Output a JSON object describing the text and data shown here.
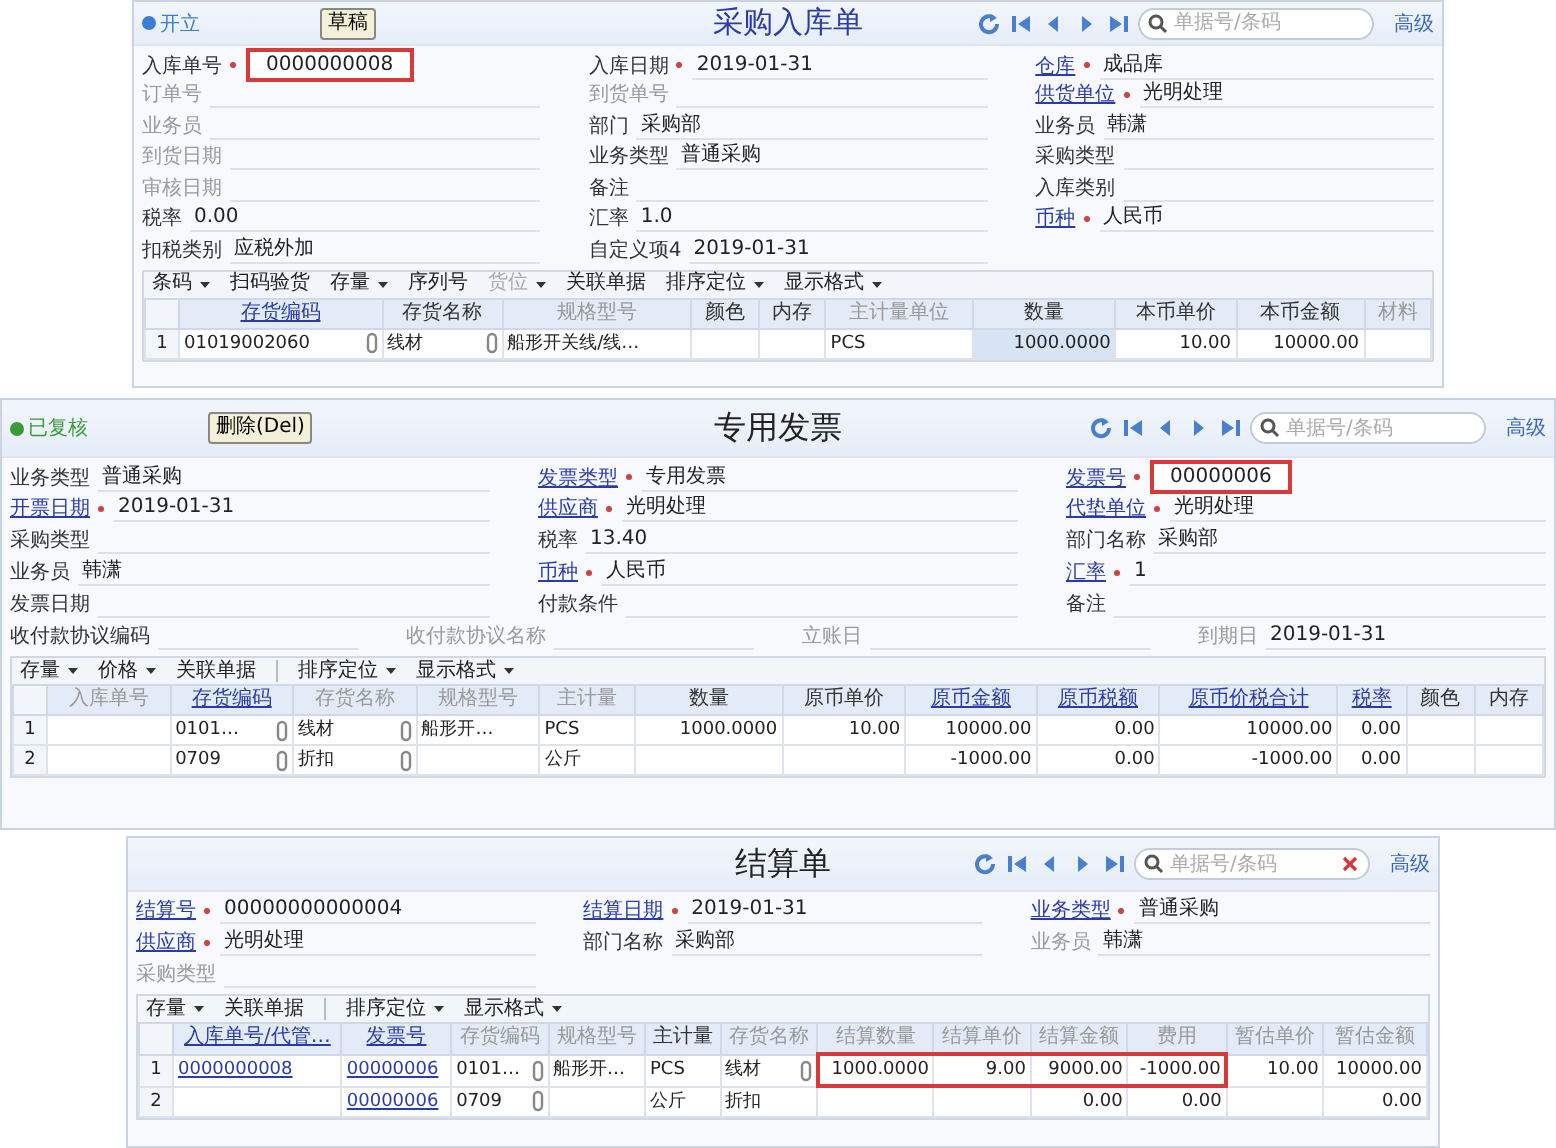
{
  "panels": [
    {
      "status": {
        "text": "开立",
        "color": "#3b7fd4"
      },
      "button": "草稿",
      "title": "采购入库单",
      "search": {
        "placeholder": "单据号/条码",
        "clearable": false
      },
      "advanced": "高级",
      "fields": [
        [
          {
            "label": "入库单号",
            "kind": "plain",
            "required": true,
            "value": "0000000008",
            "boxed": true
          },
          {
            "label": "入库日期",
            "kind": "plain",
            "required": true,
            "value": "2019-01-31"
          },
          {
            "label": "仓库",
            "kind": "link",
            "required": true,
            "value": "成品库"
          }
        ],
        [
          {
            "label": "订单号",
            "kind": "dim"
          },
          {
            "label": "到货单号",
            "kind": "dim"
          },
          {
            "label": "供货单位",
            "kind": "link",
            "required": true,
            "value": "光明处理"
          }
        ],
        [
          {
            "label": "业务员",
            "kind": "dim"
          },
          {
            "label": "部门",
            "kind": "plain",
            "value": "采购部"
          },
          {
            "label": "业务员",
            "kind": "plain",
            "value": "韩潇"
          }
        ],
        [
          {
            "label": "到货日期",
            "kind": "dim"
          },
          {
            "label": "业务类型",
            "kind": "plain",
            "value": "普通采购"
          },
          {
            "label": "采购类型",
            "kind": "plain"
          }
        ],
        [
          {
            "label": "审核日期",
            "kind": "dim"
          },
          {
            "label": "备注",
            "kind": "plain"
          },
          {
            "label": "入库类别",
            "kind": "plain"
          }
        ],
        [
          {
            "label": "税率",
            "kind": "plain",
            "value": "0.00"
          },
          {
            "label": "汇率",
            "kind": "plain",
            "value": "1.0"
          },
          {
            "label": "币种",
            "kind": "link",
            "required": true,
            "value": "人民币"
          }
        ],
        [
          {
            "label": "扣税类别",
            "kind": "plain",
            "value": "应税外加"
          },
          {
            "label": "自定义项4",
            "kind": "plain",
            "value": "2019-01-31"
          }
        ]
      ],
      "table": {
        "toolbar": [
          {
            "label": "条码",
            "dropdown": true
          },
          {
            "label": "扫码验货"
          },
          {
            "label": "存量",
            "dropdown": true
          },
          {
            "label": "序列号"
          },
          {
            "label": "货位",
            "dropdown": true,
            "disabled": true
          },
          {
            "label": "关联单据"
          },
          {
            "label": "排序定位",
            "dropdown": true
          },
          {
            "label": "显示格式",
            "dropdown": true
          }
        ],
        "columns": [
          {
            "label": "存货编码",
            "kind": "link"
          },
          {
            "label": "存货名称",
            "kind": "plain"
          },
          {
            "label": "规格型号",
            "kind": "dim"
          },
          {
            "label": "颜色",
            "kind": "plain"
          },
          {
            "label": "内存",
            "kind": "plain"
          },
          {
            "label": "主计量单位",
            "kind": "dim"
          },
          {
            "label": "数量",
            "kind": "plain"
          },
          {
            "label": "本币单价",
            "kind": "plain"
          },
          {
            "label": "本币金额",
            "kind": "plain"
          },
          {
            "label": "材料",
            "kind": "dim"
          }
        ],
        "rows": [
          {
            "number": "1",
            "cells": [
              {
                "text": "01019002060",
                "ref": true
              },
              {
                "text": "线材",
                "ref": true
              },
              {
                "text": "船形开关线/线…"
              },
              {},
              {},
              {
                "text": "PCS"
              },
              {
                "text": "1000.0000",
                "num": true,
                "selected": true
              },
              {
                "text": "10.00",
                "num": true
              },
              {
                "text": "10000.00",
                "num": true
              },
              {}
            ]
          }
        ]
      }
    },
    {
      "status": {
        "text": "已复核",
        "color": "#3a9a3a"
      },
      "button": "删除(Del)",
      "title": "专用发票",
      "search": {
        "placeholder": "单据号/条码",
        "clearable": false
      },
      "advanced": "高级",
      "fields": [
        [
          {
            "label": "业务类型",
            "kind": "plain",
            "value": "普通采购"
          },
          {
            "label": "发票类型",
            "kind": "link",
            "required": true,
            "value": "专用发票"
          },
          {
            "label": "发票号",
            "kind": "link",
            "required": true,
            "value": "00000006",
            "boxed": true
          }
        ],
        [
          {
            "label": "开票日期",
            "kind": "link",
            "required": true,
            "value": "2019-01-31"
          },
          {
            "label": "供应商",
            "kind": "link",
            "required": true,
            "value": "光明处理"
          },
          {
            "label": "代垫单位",
            "kind": "link",
            "required": true,
            "value": "光明处理"
          }
        ],
        [
          {
            "label": "采购类型",
            "kind": "plain"
          },
          {
            "label": "税率",
            "kind": "plain",
            "value": "13.40"
          },
          {
            "label": "部门名称",
            "kind": "plain",
            "value": "采购部"
          }
        ],
        [
          {
            "label": "业务员",
            "kind": "plain",
            "value": "韩潇"
          },
          {
            "label": "币种",
            "kind": "link",
            "required": true,
            "value": "人民币"
          },
          {
            "label": "汇率",
            "kind": "link",
            "required": true,
            "value": "1"
          }
        ],
        [
          {
            "label": "发票日期",
            "kind": "plain"
          },
          {
            "label": "付款条件",
            "kind": "plain"
          },
          {
            "label": "备注",
            "kind": "plain"
          }
        ],
        [
          {
            "label": "收付款协议编码",
            "kind": "plain"
          },
          {
            "label": "收付款协议名称",
            "kind": "dim"
          },
          {
            "label": "立账日",
            "kind": "dim"
          },
          {
            "label": "到期日",
            "kind": "dim",
            "value": "2019-01-31"
          }
        ]
      ],
      "table": {
        "toolbar": [
          {
            "label": "存量",
            "dropdown": true
          },
          {
            "label": "价格",
            "dropdown": true
          },
          {
            "label": "关联单据"
          },
          {
            "label": "排序定位",
            "dropdown": true,
            "separator_before": true
          },
          {
            "label": "显示格式",
            "dropdown": true
          }
        ],
        "columns": [
          {
            "label": "入库单号",
            "kind": "dim"
          },
          {
            "label": "存货编码",
            "kind": "link"
          },
          {
            "label": "存货名称",
            "kind": "dim"
          },
          {
            "label": "规格型号",
            "kind": "dim"
          },
          {
            "label": "主计量",
            "kind": "dim"
          },
          {
            "label": "数量",
            "kind": "plain"
          },
          {
            "label": "原币单价",
            "kind": "plain"
          },
          {
            "label": "原币金额",
            "kind": "link"
          },
          {
            "label": "原币税额",
            "kind": "link"
          },
          {
            "label": "原币价税合计",
            "kind": "link"
          },
          {
            "label": "税率",
            "kind": "link"
          },
          {
            "label": "颜色",
            "kind": "plain"
          },
          {
            "label": "内存",
            "kind": "plain"
          }
        ],
        "rows": [
          {
            "number": "1",
            "cells": [
              {},
              {
                "text": "0101…",
                "ref": true
              },
              {
                "text": "线材",
                "ref": true
              },
              {
                "text": "船形开…"
              },
              {
                "text": "PCS"
              },
              {
                "text": "1000.0000",
                "num": true
              },
              {
                "text": "10.00",
                "num": true
              },
              {
                "text": "10000.00",
                "num": true
              },
              {
                "text": "0.00",
                "num": true
              },
              {
                "text": "10000.00",
                "num": true
              },
              {
                "text": "0.00",
                "num": true
              },
              {},
              {}
            ]
          },
          {
            "number": "2",
            "cells": [
              {},
              {
                "text": "0709",
                "ref": true
              },
              {
                "text": "折扣",
                "ref": true
              },
              {},
              {
                "text": "公斤"
              },
              {},
              {},
              {
                "text": "-1000.00",
                "num": true
              },
              {
                "text": "0.00",
                "num": true
              },
              {
                "text": "-1000.00",
                "num": true
              },
              {
                "text": "0.00",
                "num": true
              },
              {},
              {}
            ]
          }
        ]
      }
    },
    {
      "title": "结算单",
      "search": {
        "placeholder": "单据号/条码",
        "clearable": true
      },
      "advanced": "高级",
      "fields": [
        [
          {
            "label": "结算号",
            "kind": "link",
            "required": true,
            "value": "00000000000004"
          },
          {
            "label": "结算日期",
            "kind": "link",
            "required": true,
            "value": "2019-01-31"
          },
          {
            "label": "业务类型",
            "kind": "link",
            "required": true,
            "value": "普通采购"
          }
        ],
        [
          {
            "label": "供应商",
            "kind": "link",
            "required": true,
            "value": "光明处理"
          },
          {
            "label": "部门名称",
            "kind": "plain",
            "value": "采购部"
          },
          {
            "label": "业务员",
            "kind": "dim",
            "value": "韩潇"
          }
        ],
        [
          {
            "label": "采购类型",
            "kind": "dim"
          }
        ]
      ],
      "table": {
        "toolbar": [
          {
            "label": "存量",
            "dropdown": true
          },
          {
            "label": "关联单据"
          },
          {
            "label": "排序定位",
            "dropdown": true,
            "separator_before": true
          },
          {
            "label": "显示格式",
            "dropdown": true
          }
        ],
        "columns": [
          {
            "label": "入库单号/代管…",
            "kind": "link"
          },
          {
            "label": "发票号",
            "kind": "link"
          },
          {
            "label": "存货编码",
            "kind": "dim"
          },
          {
            "label": "规格型号",
            "kind": "dim"
          },
          {
            "label": "主计量",
            "kind": "plain"
          },
          {
            "label": "存货名称",
            "kind": "dim"
          },
          {
            "label": "结算数量",
            "kind": "dim"
          },
          {
            "label": "结算单价",
            "kind": "dim"
          },
          {
            "label": "结算金额",
            "kind": "dim"
          },
          {
            "label": "费用",
            "kind": "dim"
          },
          {
            "label": "暂估单价",
            "kind": "dim"
          },
          {
            "label": "暂估金额",
            "kind": "dim"
          }
        ],
        "rows": [
          {
            "number": "1",
            "cells": [
              {
                "text": "0000000008",
                "link": true
              },
              {
                "text": "00000006",
                "link": true
              },
              {
                "text": "0101…",
                "ref": true
              },
              {
                "text": "船形开…"
              },
              {
                "text": "PCS"
              },
              {
                "text": "线材",
                "ref": true
              },
              {
                "text": "1000.0000",
                "num": true,
                "boxed": true
              },
              {
                "text": "9.00",
                "num": true,
                "boxed": true
              },
              {
                "text": "9000.00",
                "num": true,
                "boxed": true
              },
              {
                "text": "-1000.00",
                "num": true,
                "boxed": true
              },
              {
                "text": "10.00",
                "num": true
              },
              {
                "text": "10000.00",
                "num": true
              }
            ]
          },
          {
            "number": "2",
            "cells": [
              {},
              {
                "text": "00000006",
                "link": true
              },
              {
                "text": "0709",
                "ref": true
              },
              {},
              {
                "text": "公斤"
              },
              {
                "text": "折扣"
              },
              {},
              {},
              {
                "text": "0.00",
                "num": true
              },
              {
                "text": "0.00",
                "num": true
              },
              {},
              {
                "text": "0.00",
                "num": true
              }
            ]
          }
        ]
      }
    }
  ]
}
